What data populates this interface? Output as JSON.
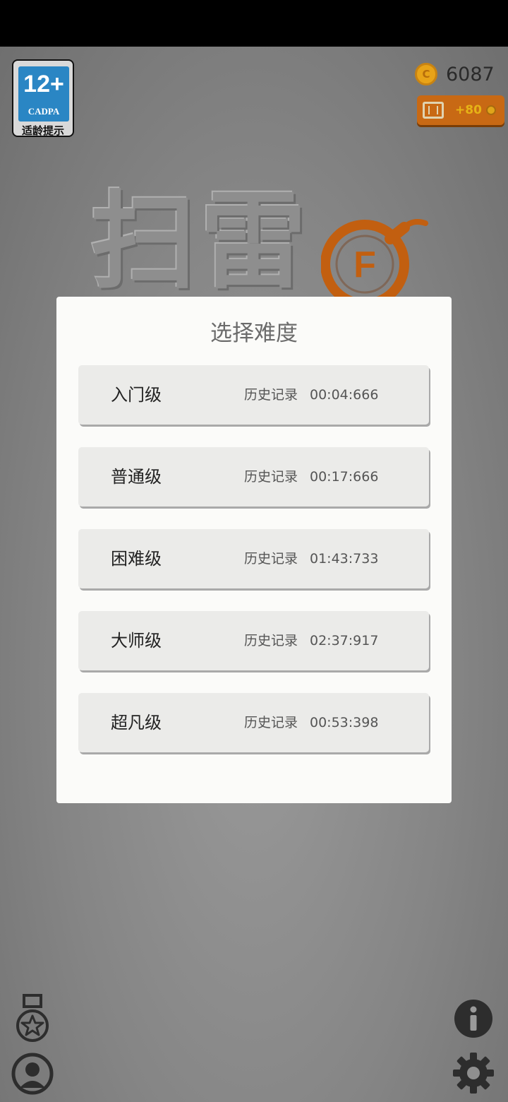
{
  "age_badge": {
    "rating": "12+",
    "org": "CADPA",
    "caption": "适龄提示"
  },
  "coins": {
    "count": "6087",
    "coin_symbol": "C"
  },
  "reward": {
    "label": "+80"
  },
  "logo": {
    "title": "扫雷",
    "badge_letter": "F"
  },
  "dialog": {
    "title": "选择难度",
    "levels": [
      {
        "name": "入门级",
        "record_label": "历史记录",
        "record_time": "00:04:666"
      },
      {
        "name": "普通级",
        "record_label": "历史记录",
        "record_time": "00:17:666"
      },
      {
        "name": "困难级",
        "record_label": "历史记录",
        "record_time": "01:43:733"
      },
      {
        "name": "大师级",
        "record_label": "历史记录",
        "record_time": "02:37:917"
      },
      {
        "name": "超凡级",
        "record_label": "历史记录",
        "record_time": "00:53:398"
      }
    ]
  },
  "colors": {
    "accent_orange": "#c86914",
    "coin_gold": "#e8a318",
    "age_blue": "#2a86c4"
  },
  "icons": {
    "achievements": "medal-star-icon",
    "profile": "user-icon",
    "info": "info-icon",
    "settings": "gear-icon"
  }
}
